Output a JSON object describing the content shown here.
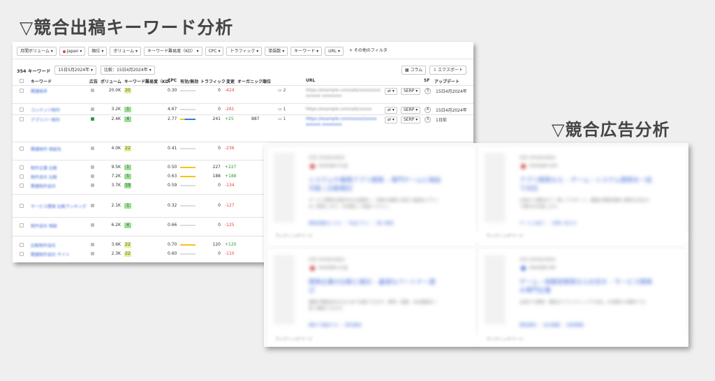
{
  "headings": {
    "competitor_keywords": "▽競合出稿キーワード分析",
    "competitor_ads": "▽競合広告分析"
  },
  "keyword_panel": {
    "filters": [
      "月間ボリューム ▾",
      "Japan ▾",
      "順位 ▾",
      "ボリューム ▾",
      "キーワード難易度（KD） ▾",
      "CPC ▾",
      "トラフィック ▾",
      "単語数 ▾",
      "キーワード ▾",
      "URL ▾",
      "+ その他のフィルタ"
    ],
    "count": "354 キーワード",
    "date_current": "15日5月2024年 ▾",
    "date_compare": "比較：15日4月2024年 ▾",
    "btn_columns": "コラム",
    "btn_export": "エクスポート",
    "columns": {
      "keyword": "キーワード",
      "ad": "広告",
      "volume": "ボリューム",
      "kd": "キーワード難易度（KD）",
      "cpc": "CPC",
      "paid_organic": "有効/無効",
      "traffic": "トラフィック",
      "change": "変更",
      "organic": "オーガニック",
      "position": "順位",
      "url": "URL",
      "sf": "SF",
      "updated": "アップデート"
    },
    "rows": [
      {
        "keyword": "関連相手",
        "volume": "20.0K",
        "kd": "20",
        "cpc": "0.30",
        "traffic": "0",
        "change": "-424",
        "organic": "",
        "position": "2",
        "url": "https://example.com/ads/xxxx/xxxx xxxxxx xxxxxxxx",
        "updated": "15日4月2024年",
        "sf": "3"
      },
      {
        "keyword": "コンテンツ制作",
        "volume": "3.2K",
        "kd": "1",
        "cpc": "4.67",
        "traffic": "0",
        "change": "-261",
        "organic": "",
        "position": "1",
        "url": "https://example.com/ads/xxxxx",
        "updated": "15日4月2024年",
        "sf": "4"
      },
      {
        "keyword": "アプリバー制作",
        "volume": "2.4K",
        "kd": "4",
        "cpc": "2.77",
        "traffic": "241",
        "change": "+25",
        "organic": "887",
        "position": "1",
        "url": "https://example.com/xxxxx/xxxxx xxxxxx xxxxxxxx",
        "updated": "1日前",
        "sf": "3"
      },
      {
        "keyword": "関連制作 相談先",
        "volume": "4.0K",
        "kd": "22",
        "cpc": "0.41",
        "traffic": "0",
        "change": "-236"
      },
      {
        "keyword": "制作企業 比較",
        "volume": "9.5K",
        "kd": "1",
        "cpc": "0.50",
        "traffic": "227",
        "change": "+227"
      },
      {
        "keyword": "制作会社 比較",
        "volume": "7.2K",
        "kd": "5",
        "cpc": "0.63",
        "traffic": "188",
        "change": "+188"
      },
      {
        "keyword": "関連制作会社",
        "volume": "3.7K",
        "kd": "19",
        "cpc": "0.59",
        "traffic": "0",
        "change": "-134"
      },
      {
        "keyword": "サービス開発 比較ランキング",
        "volume": "2.1K",
        "kd": "1",
        "cpc": "0.32",
        "traffic": "0",
        "change": "-127"
      },
      {
        "keyword": "制作会社 相談",
        "volume": "6.2K",
        "kd": "4",
        "cpc": "0.66",
        "traffic": "0",
        "change": "-125"
      },
      {
        "keyword": "比較制作会社",
        "volume": "3.6K",
        "kd": "22",
        "cpc": "0.70",
        "traffic": "120",
        "change": "+120"
      },
      {
        "keyword": "関連制作会社 サイト",
        "volume": "2.3K",
        "kd": "22",
        "cpc": "0.60",
        "traffic": "0",
        "change": "-110"
      }
    ]
  },
  "ad_panel": {
    "cards": [
      {
        "label": "広告 SPONSORED",
        "site": "example.co.jp",
        "title": "システムや業務アプリ開発 – 専門チームに相談可能 | 比較検討",
        "desc": "サービス開発を検討中の企業様へ。多数の実績と知見で最適なプランをご提案します。お気軽にご相談ください。",
        "links": "開発実績はこちら ｜ 料金プラン ｜ 導入事例",
        "foot": "ランディングページ"
      },
      {
        "label": "広告 SPONSORED",
        "site": "example.com",
        "title": "アプリ開発なら – ゲーム・システム開発を一括で対応",
        "desc": "企画から運用まで一貫してサポート。豊富な開発実績と柔軟な対応力で御社を支援します。",
        "links": "サービス紹介 ｜ お問い合わせ",
        "foot": "ランディングページ"
      },
      {
        "label": "広告 SPONSORED",
        "site": "example.co.jp",
        "title": "開発企業の比較と検討 – 最適なパートナー選び",
        "desc": "複数の開発会社をまとめて比較できます。費用・実績・対応範囲を一覧で確認できます。",
        "links": "無料で相談する ｜ 資料請求",
        "foot": "ランディングページ"
      },
      {
        "label": "広告 SPONSORED",
        "site": "example.net",
        "title": "ゲーム・体験型開発ならお任せ – サービス開発の専門企業",
        "desc": "企画から開発・運用までワンストップで対応。お見積りは無料です。",
        "links": "開発事例 ｜ 会社概要 ｜ 採用情報",
        "foot": "ランディングページ"
      }
    ]
  }
}
